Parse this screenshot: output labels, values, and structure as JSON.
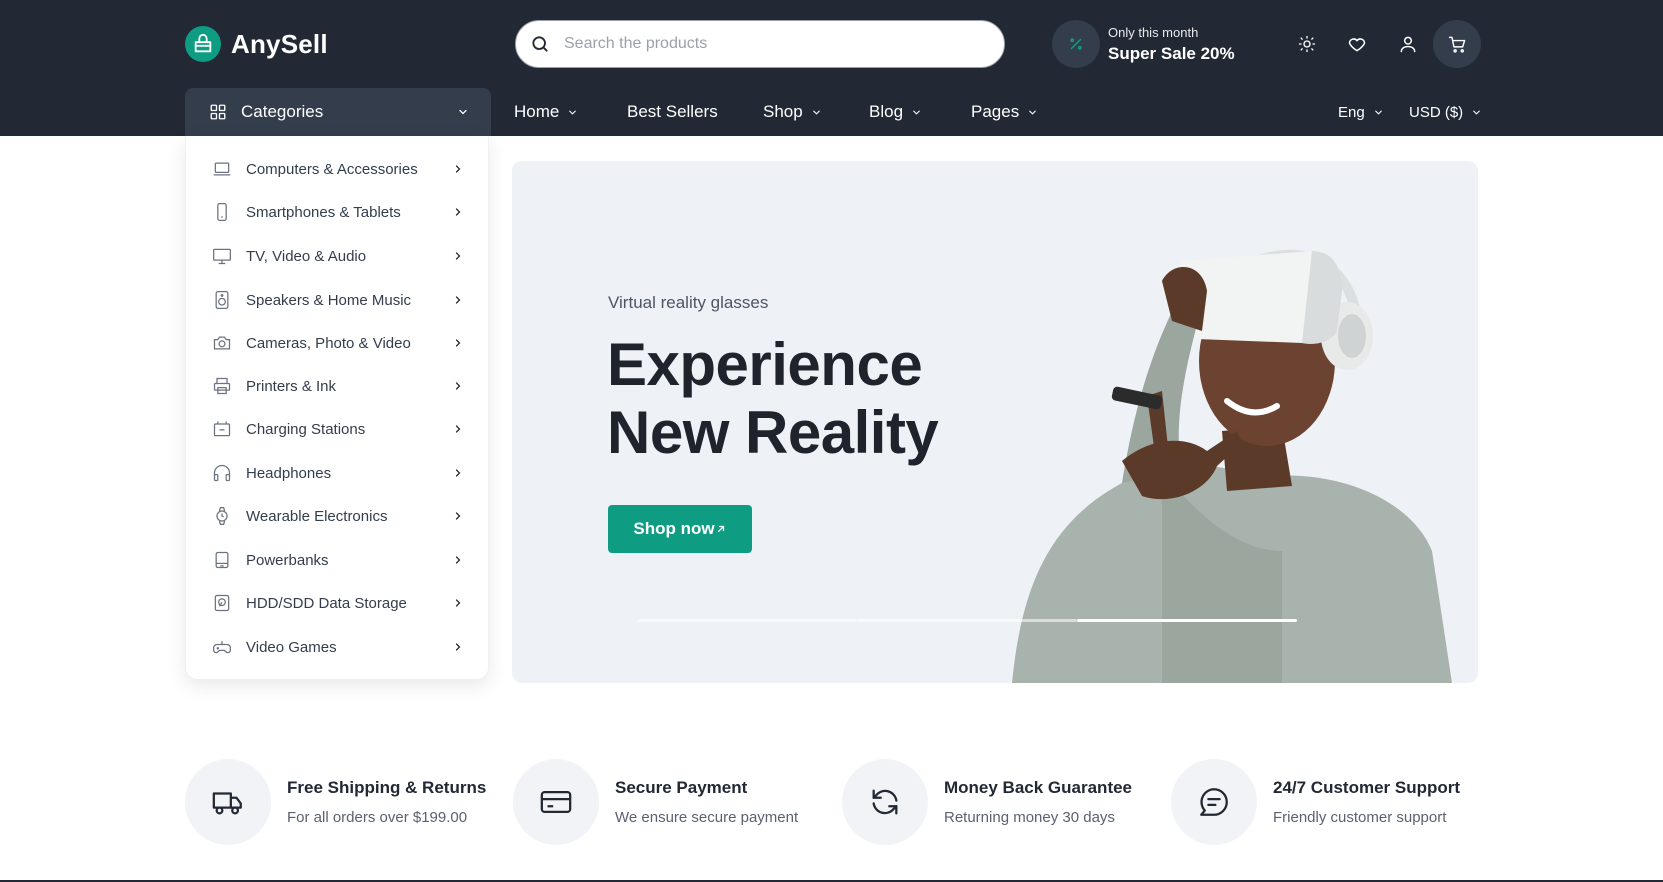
{
  "brand": {
    "name": "AnySell",
    "accent": "#0e9d82",
    "dark": "#222934"
  },
  "search": {
    "placeholder": "Search the products"
  },
  "promo": {
    "small": "Only this month",
    "big": "Super Sale 20%"
  },
  "header_icons": [
    "sun-icon",
    "heart-icon",
    "user-icon",
    "cart-icon"
  ],
  "categories_button": {
    "label": "Categories"
  },
  "nav": [
    {
      "label": "Home",
      "dropdown": true
    },
    {
      "label": "Best Sellers",
      "dropdown": false
    },
    {
      "label": "Shop",
      "dropdown": true
    },
    {
      "label": "Blog",
      "dropdown": true
    },
    {
      "label": "Pages",
      "dropdown": true
    }
  ],
  "language": "Eng",
  "currency": "USD ($)",
  "categories": [
    {
      "label": "Computers & Accessories",
      "icon": "laptop-icon"
    },
    {
      "label": "Smartphones & Tablets",
      "icon": "smartphone-icon"
    },
    {
      "label": "TV, Video & Audio",
      "icon": "monitor-icon"
    },
    {
      "label": "Speakers & Home Music",
      "icon": "speaker-icon"
    },
    {
      "label": "Cameras, Photo & Video",
      "icon": "camera-icon"
    },
    {
      "label": "Printers & Ink",
      "icon": "printer-icon"
    },
    {
      "label": "Charging Stations",
      "icon": "battery-icon"
    },
    {
      "label": "Headphones",
      "icon": "headphones-icon"
    },
    {
      "label": "Wearable Electronics",
      "icon": "watch-icon"
    },
    {
      "label": "Powerbanks",
      "icon": "powerbank-icon"
    },
    {
      "label": "HDD/SDD Data Storage",
      "icon": "harddrive-icon"
    },
    {
      "label": "Video Games",
      "icon": "gamepad-icon"
    }
  ],
  "hero": {
    "subtitle": "Virtual reality glasses",
    "title_line1": "Experience",
    "title_line2": "New Reality",
    "cta": "Shop now",
    "slides_total": 3,
    "active_slide": 3
  },
  "features": [
    {
      "title": "Free Shipping & Returns",
      "desc": "For all orders over $199.00",
      "icon": "truck-icon"
    },
    {
      "title": "Secure Payment",
      "desc": "We ensure secure payment",
      "icon": "credit-card-icon"
    },
    {
      "title": "Money Back Guarantee",
      "desc": "Returning money 30 days",
      "icon": "refresh-icon"
    },
    {
      "title": "24/7 Customer Support",
      "desc": "Friendly customer support",
      "icon": "chat-icon"
    }
  ]
}
